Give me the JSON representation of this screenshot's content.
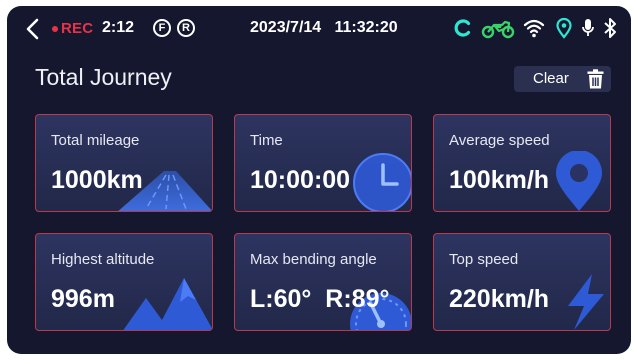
{
  "status_bar": {
    "rec_label": "REC",
    "rec_time": "2:12",
    "badge_f": "F",
    "badge_r": "R",
    "datetime": "2023/7/14   11:32:20",
    "icons": [
      "back-arrow-icon",
      "rec-dot-icon",
      "sync-icon",
      "motorcycle-icon",
      "wifi-icon",
      "location-icon",
      "microphone-icon",
      "bluetooth-icon"
    ]
  },
  "header": {
    "title": "Total Journey",
    "clear_label": "Clear"
  },
  "cards": [
    {
      "label": "Total mileage",
      "value": "1000km",
      "icon": "road-icon"
    },
    {
      "label": "Time",
      "value": "10:00:00",
      "icon": "clock-icon"
    },
    {
      "label": "Average speed",
      "value": "100km/h",
      "icon": "map-pin-icon"
    },
    {
      "label": "Highest altitude",
      "value": "996m",
      "icon": "mountain-icon"
    },
    {
      "label": "Max bending angle",
      "value": "L:60°  R:89°",
      "icon": "gauge-icon"
    },
    {
      "label": "Top speed",
      "value": "220km/h",
      "icon": "lightning-icon"
    }
  ],
  "colors": {
    "background": "#14172e",
    "card_top": "#2d3460",
    "card_bottom": "#222849",
    "card_border": "#b83a4c",
    "rec_red": "#e8324a",
    "accent_cyan": "#2ee6d2",
    "accent_green": "#3ad36a",
    "icon_blue": "#2f5ad6"
  }
}
